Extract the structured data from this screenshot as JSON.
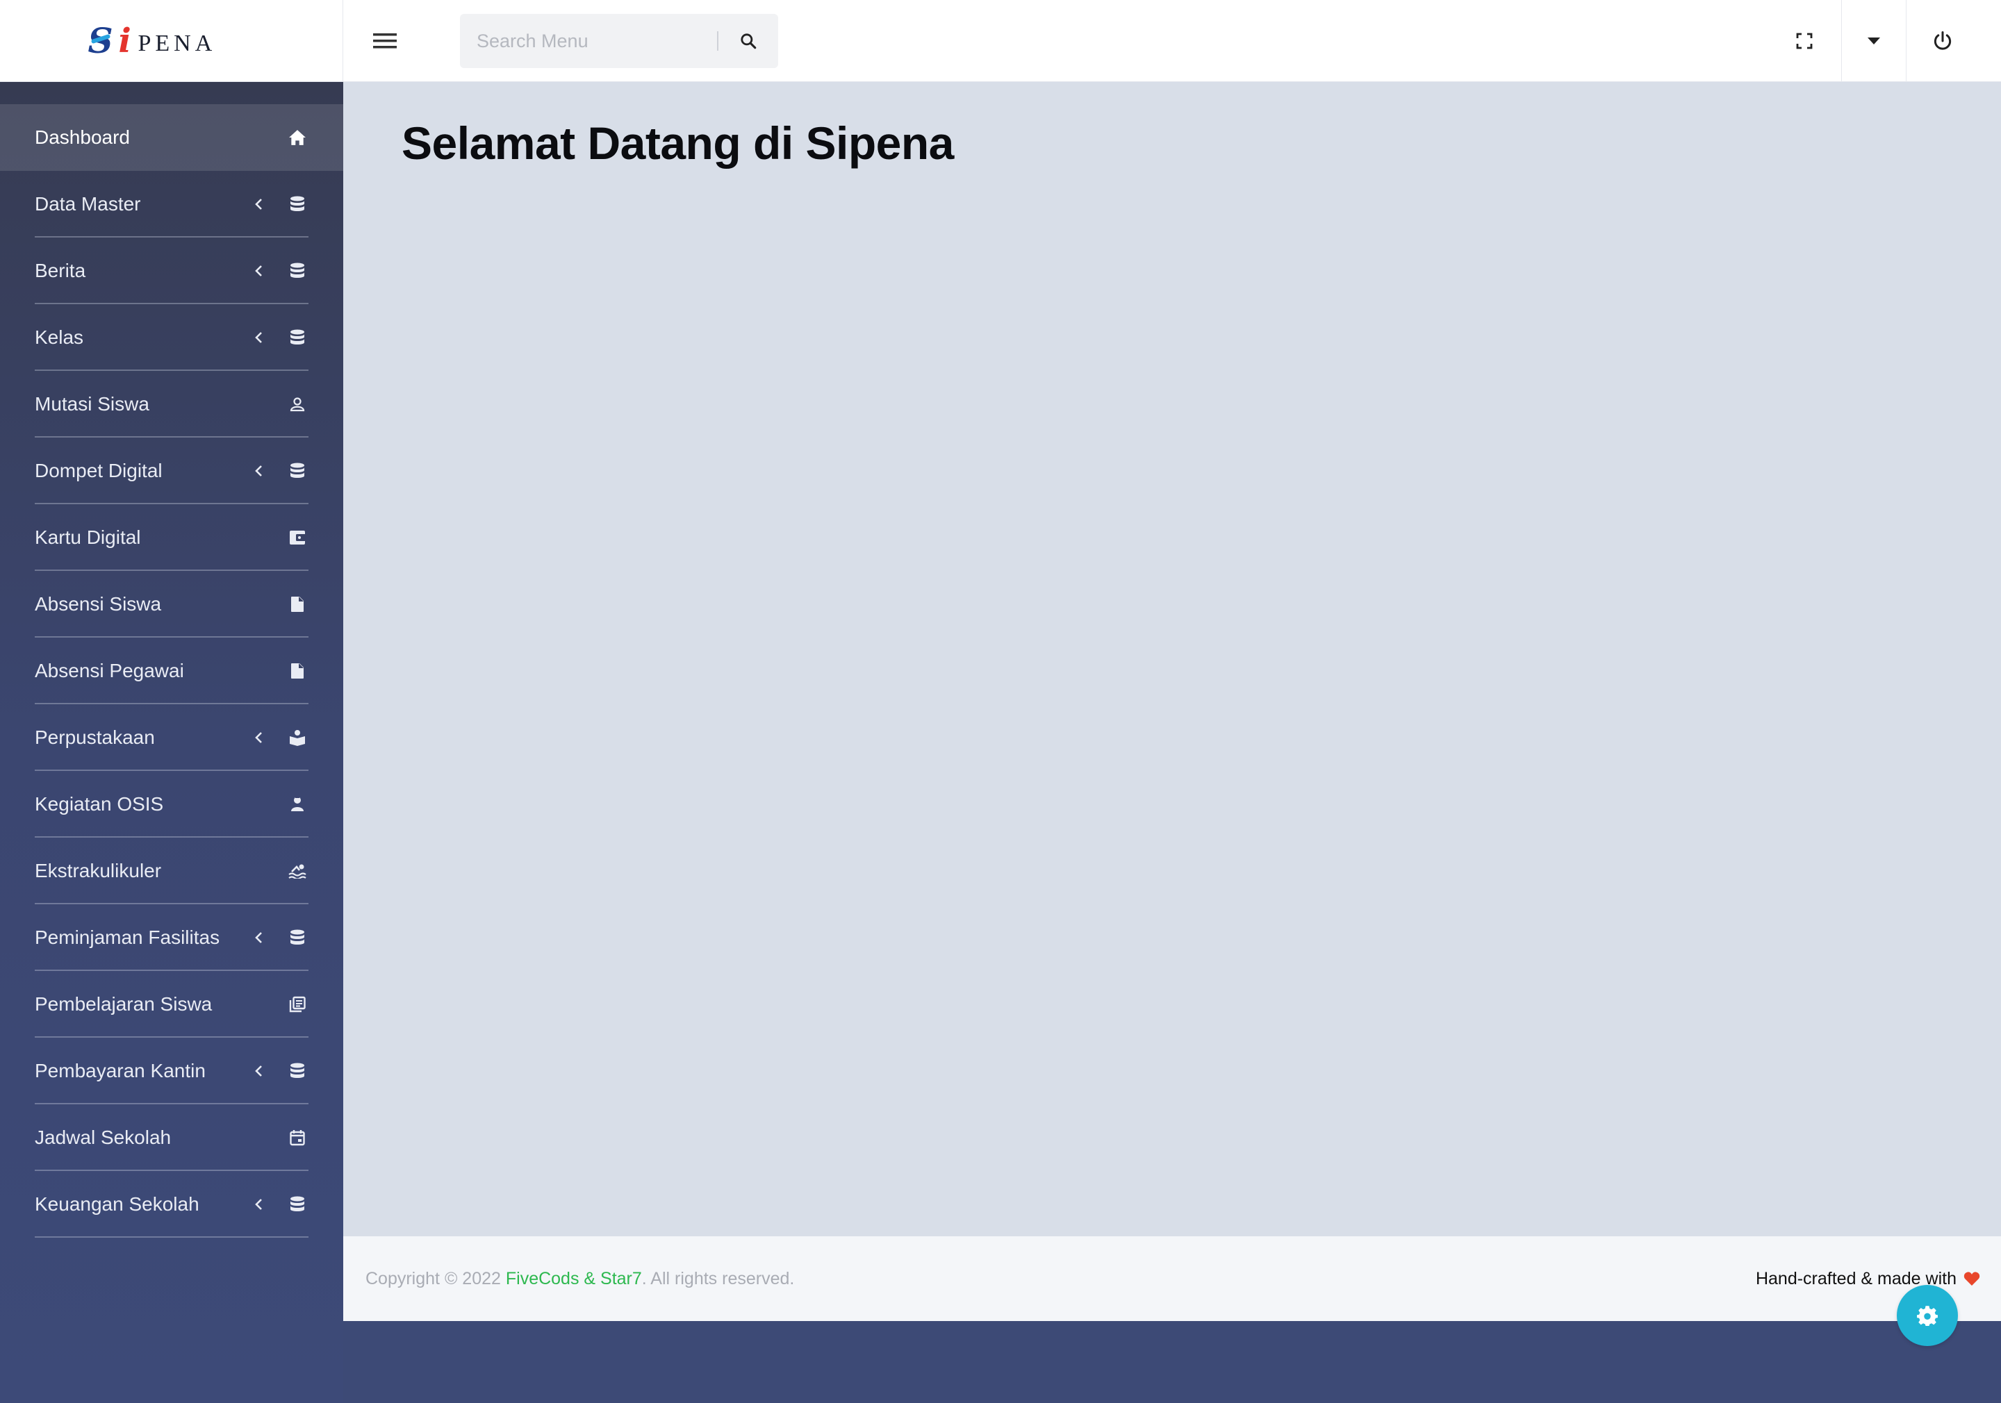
{
  "brand": {
    "first_letter": "S",
    "second_letter": "i",
    "rest": "PENA"
  },
  "header": {
    "search_placeholder": "Search Menu",
    "icons": {
      "menu_toggle": "hamburger-icon",
      "search": "search-icon",
      "fullscreen": "fullscreen-icon",
      "dropdown": "caret-down-icon",
      "power": "power-icon"
    }
  },
  "sidebar": {
    "items": [
      {
        "label": "Dashboard",
        "icon": "home-icon",
        "has_submenu": false,
        "active": true
      },
      {
        "label": "Data Master",
        "icon": "database-icon",
        "has_submenu": true,
        "active": false
      },
      {
        "label": "Berita",
        "icon": "database-icon",
        "has_submenu": true,
        "active": false
      },
      {
        "label": "Kelas",
        "icon": "database-icon",
        "has_submenu": true,
        "active": false
      },
      {
        "label": "Mutasi Siswa",
        "icon": "user-icon",
        "has_submenu": false,
        "active": false
      },
      {
        "label": "Dompet Digital",
        "icon": "database-icon",
        "has_submenu": true,
        "active": false
      },
      {
        "label": "Kartu Digital",
        "icon": "wallet-icon",
        "has_submenu": false,
        "active": false
      },
      {
        "label": "Absensi Siswa",
        "icon": "file-icon",
        "has_submenu": false,
        "active": false
      },
      {
        "label": "Absensi Pegawai",
        "icon": "file-icon",
        "has_submenu": false,
        "active": false
      },
      {
        "label": "Perpustakaan",
        "icon": "reader-icon",
        "has_submenu": true,
        "active": false
      },
      {
        "label": "Kegiatan OSIS",
        "icon": "person-badge-icon",
        "has_submenu": false,
        "active": false
      },
      {
        "label": "Ekstrakulikuler",
        "icon": "swimming-icon",
        "has_submenu": false,
        "active": false
      },
      {
        "label": "Peminjaman Fasilitas",
        "icon": "database-icon",
        "has_submenu": true,
        "active": false
      },
      {
        "label": "Pembelajaran Siswa",
        "icon": "library-books-icon",
        "has_submenu": false,
        "active": false
      },
      {
        "label": "Pembayaran Kantin",
        "icon": "database-icon",
        "has_submenu": true,
        "active": false
      },
      {
        "label": "Jadwal Sekolah",
        "icon": "calendar-icon",
        "has_submenu": false,
        "active": false
      },
      {
        "label": "Keuangan Sekolah",
        "icon": "database-icon",
        "has_submenu": true,
        "active": false
      }
    ]
  },
  "main": {
    "title": "Selamat Datang di Sipena"
  },
  "footer": {
    "copyright_prefix": "Copyright © 2022 ",
    "copyright_link": "FiveCods & Star7",
    "copyright_suffix": ". All rights reserved.",
    "right_text": "Hand-crafted & made with",
    "heart_icon": "heart-icon",
    "settings_icon": "gear-icon"
  },
  "colors": {
    "sidebar_top": "#363b52",
    "sidebar_bottom": "#3d4a78",
    "content_bg": "#d8dee8",
    "footer_link": "#2db84f",
    "heart": "#e8472c",
    "fab": "#20b4d4"
  }
}
